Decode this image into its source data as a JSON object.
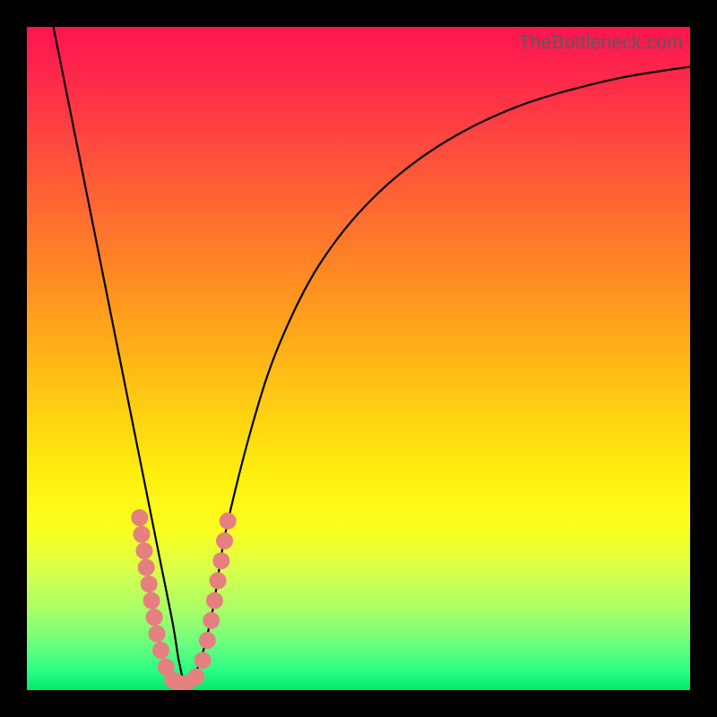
{
  "watermark": "TheBottleneck.com",
  "colors": {
    "curve_stroke": "#000000",
    "marker_fill": "#e68080",
    "marker_stroke": "#e68080"
  },
  "chart_data": {
    "type": "line",
    "title": "",
    "xlabel": "",
    "ylabel": "",
    "xlim": [
      0,
      100
    ],
    "ylim": [
      0,
      100
    ],
    "series": [
      {
        "name": "bottleneck-curve",
        "x": [
          4,
          6,
          8,
          10,
          12,
          14,
          16,
          18,
          20,
          22,
          23,
          24,
          26,
          28,
          30,
          34,
          38,
          44,
          52,
          62,
          74,
          88,
          100
        ],
        "y": [
          100,
          90,
          80,
          70,
          60,
          50,
          40,
          30,
          20,
          10,
          4,
          1,
          4,
          12,
          24,
          40,
          52,
          64,
          74,
          82,
          88,
          92,
          94
        ]
      }
    ],
    "markers": [
      {
        "x": 17.0,
        "y": 26.0
      },
      {
        "x": 17.3,
        "y": 23.5
      },
      {
        "x": 17.7,
        "y": 21.0
      },
      {
        "x": 18.0,
        "y": 18.5
      },
      {
        "x": 18.4,
        "y": 16.0
      },
      {
        "x": 18.8,
        "y": 13.5
      },
      {
        "x": 19.2,
        "y": 11.0
      },
      {
        "x": 19.6,
        "y": 8.5
      },
      {
        "x": 20.2,
        "y": 6.0
      },
      {
        "x": 21.0,
        "y": 3.5
      },
      {
        "x": 22.0,
        "y": 1.5
      },
      {
        "x": 23.0,
        "y": 1.0
      },
      {
        "x": 24.0,
        "y": 1.0
      },
      {
        "x": 25.5,
        "y": 2.0
      },
      {
        "x": 26.5,
        "y": 4.5
      },
      {
        "x": 27.2,
        "y": 7.5
      },
      {
        "x": 27.8,
        "y": 10.5
      },
      {
        "x": 28.3,
        "y": 13.5
      },
      {
        "x": 28.8,
        "y": 16.5
      },
      {
        "x": 29.3,
        "y": 19.5
      },
      {
        "x": 29.8,
        "y": 22.5
      },
      {
        "x": 30.3,
        "y": 25.5
      }
    ]
  }
}
